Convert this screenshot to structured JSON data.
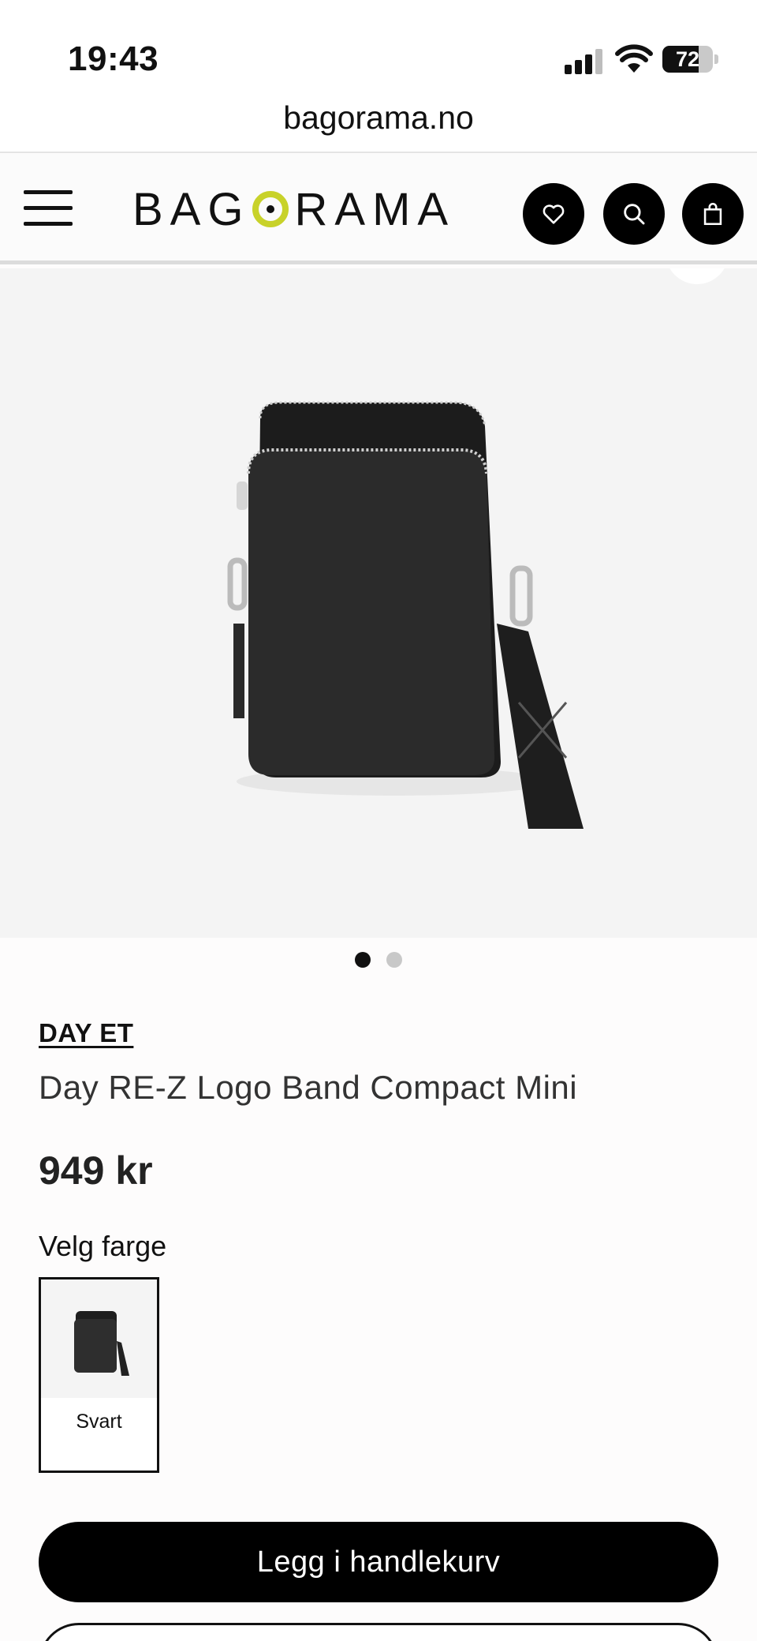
{
  "status_bar": {
    "time": "19:43",
    "battery_level": "72"
  },
  "browser": {
    "url": "bagorama.no"
  },
  "header": {
    "logo_left": "BAG",
    "logo_right": "RAMA",
    "logo_accent_color": "#c8d22a",
    "icons": [
      "menu-icon",
      "heart-icon",
      "search-icon",
      "shopping-bag-icon"
    ]
  },
  "gallery": {
    "image_count": 2,
    "active_index": 0
  },
  "product": {
    "brand": "DAY ET",
    "title": "Day RE-Z Logo Band Compact Mini",
    "price": "949 kr",
    "color_label": "Velg farge",
    "colors": [
      {
        "name": "Svart",
        "selected": true
      }
    ]
  },
  "actions": {
    "add_to_cart_label": "Legg i handlekurv"
  }
}
